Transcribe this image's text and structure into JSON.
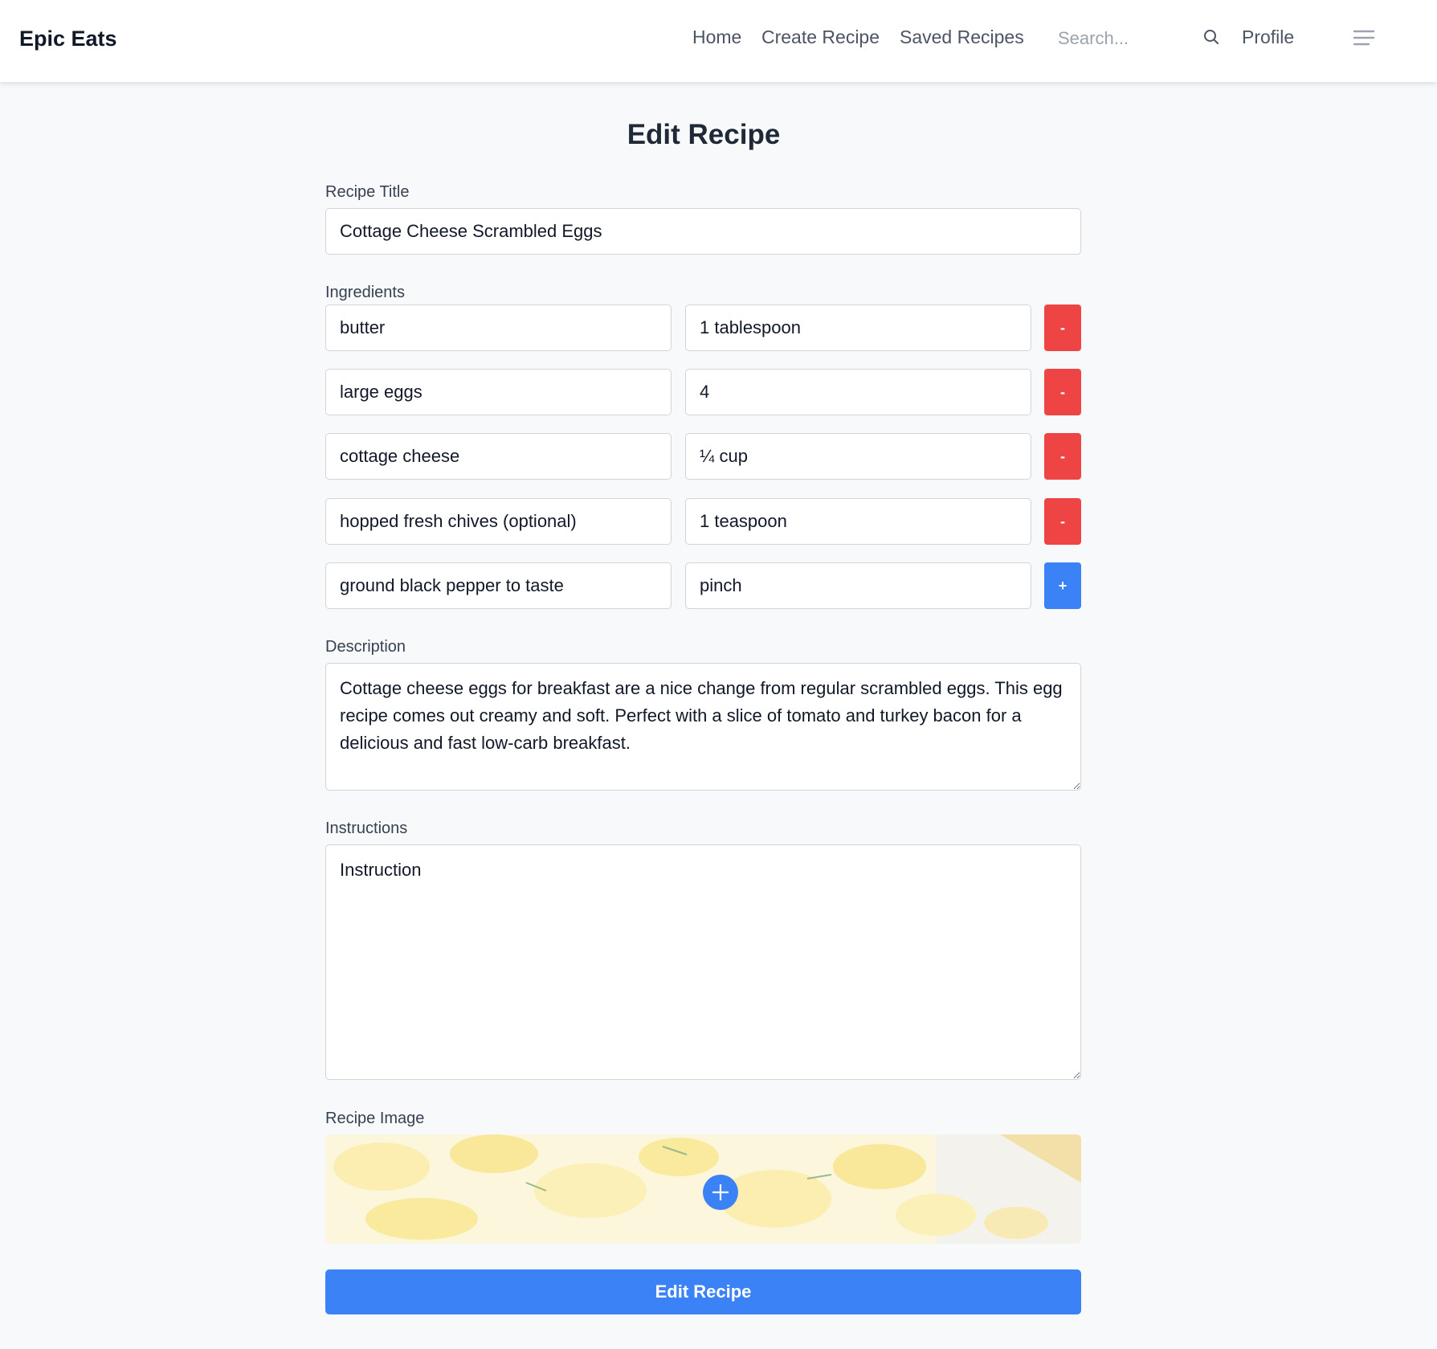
{
  "nav": {
    "brand": "Epic Eats",
    "links": [
      "Home",
      "Create Recipe",
      "Saved Recipes"
    ],
    "search_placeholder": "Search...",
    "profile": "Profile"
  },
  "page_title": "Edit Recipe",
  "form": {
    "title_label": "Recipe Title",
    "title_value": "Cottage Cheese Scrambled Eggs",
    "ingredients_label": "Ingredients",
    "ingredients": [
      {
        "name": "butter",
        "amount": "1 tablespoon",
        "action": "-"
      },
      {
        "name": "large eggs",
        "amount": "4",
        "action": "-"
      },
      {
        "name": "cottage cheese",
        "amount": "¼ cup",
        "action": "-"
      },
      {
        "name": "hopped fresh chives (optional)",
        "amount": "1 teaspoon",
        "action": "-"
      },
      {
        "name": "ground black pepper to taste",
        "amount": "pinch",
        "action": "+"
      }
    ],
    "description_label": "Description",
    "description_value": "Cottage cheese eggs for breakfast are a nice change from regular scrambled eggs. This egg recipe comes out creamy and soft. Perfect with a slice of tomato and turkey bacon for a delicious and fast low-carb breakfast.",
    "instructions_label": "Instructions",
    "instructions_placeholder": "Instruction",
    "image_label": "Recipe Image",
    "submit_label": "Edit Recipe"
  },
  "colors": {
    "primary": "#3b82f6",
    "danger": "#ef4444",
    "page_bg": "#f8f9fa"
  }
}
